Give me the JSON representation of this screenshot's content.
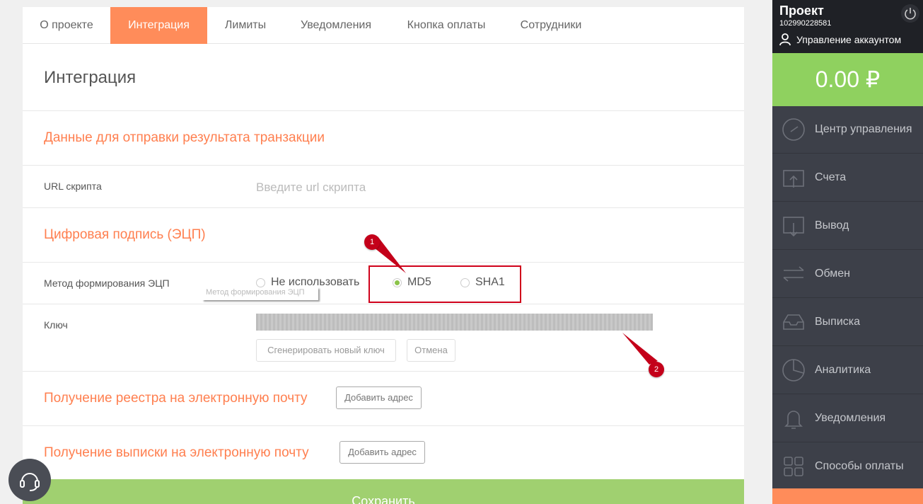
{
  "tabs": [
    {
      "label": "О проекте",
      "active": false
    },
    {
      "label": "Интеграция",
      "active": true
    },
    {
      "label": "Лимиты",
      "active": false
    },
    {
      "label": "Уведомления",
      "active": false
    },
    {
      "label": "Кнопка оплаты",
      "active": false
    },
    {
      "label": "Сотрудники",
      "active": false
    }
  ],
  "page_title": "Интеграция",
  "transaction_section": {
    "title": "Данные для отправки результата транзакции",
    "url_label": "URL скрипта",
    "url_value": "",
    "url_placeholder": "Введите url скрипта"
  },
  "signature_section": {
    "title": "Цифровая подпись (ЭЦП)",
    "method_label": "Метод формирования ЭЦП",
    "options": [
      "Не использовать",
      "MD5",
      "SHA1"
    ],
    "selected": "MD5",
    "tooltip": "Метод формирования ЭЦП",
    "key_label": "Ключ",
    "generate_button": "Сгенерировать новый ключ",
    "cancel_button": "Отмена"
  },
  "registry_section": {
    "title": "Получение реестра на электронную почту",
    "add_button": "Добавить адрес"
  },
  "statement_section": {
    "title": "Получение выписки на электронную почту",
    "add_button": "Добавить адрес"
  },
  "save_button": "Сохранить",
  "annotations": [
    "1",
    "2"
  ],
  "sidebar": {
    "project_name": "Проект",
    "project_id": "102990228581",
    "account_link": "Управление аккаунтом",
    "balance": "0.00 ₽",
    "items": [
      {
        "label": "Центр управления",
        "icon": "dashboard-gauge-icon"
      },
      {
        "label": "Счета",
        "icon": "wallet-in-icon"
      },
      {
        "label": "Вывод",
        "icon": "wallet-out-icon"
      },
      {
        "label": "Обмен",
        "icon": "exchange-arrows-icon"
      },
      {
        "label": "Выписка",
        "icon": "inbox-tray-icon"
      },
      {
        "label": "Аналитика",
        "icon": "pie-chart-icon"
      },
      {
        "label": "Уведомления",
        "icon": "bell-icon"
      },
      {
        "label": "Способы оплаты",
        "icon": "grid-squares-icon"
      }
    ]
  },
  "colors": {
    "accent": "#ff8c5a",
    "section_title": "#ff7f4f",
    "balance_bg": "#8fd15f",
    "save_bg": "#a0d070",
    "sidebar_bg": "#3d4049",
    "annotation": "#d0021b"
  }
}
